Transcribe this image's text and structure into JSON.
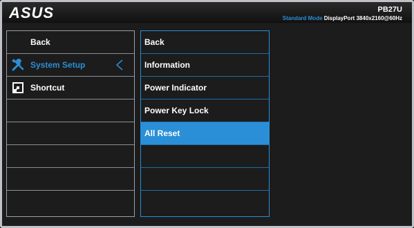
{
  "header": {
    "brand": "ASUS",
    "model": "PB27U",
    "mode": "Standard Mode",
    "input": "DisplayPort",
    "resolution": "3840x2160@60Hz"
  },
  "left_menu": {
    "items": [
      {
        "label": "Back",
        "icon": ""
      },
      {
        "label": "System Setup",
        "icon": "wrench-screwdriver-icon",
        "active": true
      },
      {
        "label": "Shortcut",
        "icon": "shortcut-icon"
      }
    ]
  },
  "right_menu": {
    "items": [
      {
        "label": "Back"
      },
      {
        "label": "Information"
      },
      {
        "label": "Power Indicator"
      },
      {
        "label": "Power Key Lock"
      },
      {
        "label": "All Reset",
        "selected": true
      }
    ]
  },
  "colors": {
    "accent": "#2a8fd6",
    "background": "#1c1c1c",
    "border": "#9aa0a6"
  }
}
